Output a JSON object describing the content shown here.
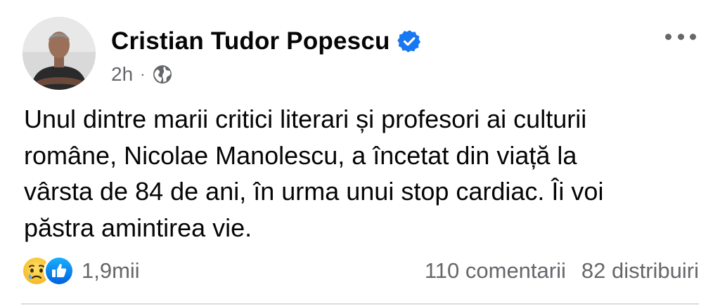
{
  "post": {
    "author": "Cristian Tudor Popescu",
    "verified": true,
    "time": "2h",
    "separator": "·",
    "audience_icon": "globe-icon",
    "text_lines": [
      "Unul dintre marii critici literari și profesori ai culturii",
      "române, Nicolae Manolescu, a încetat din viață la",
      "vârsta de 84 de ani, în urma unui stop cardiac. Îi voi",
      "păstra amintirea vie."
    ],
    "reactions": {
      "icons": [
        "sad-reaction-icon",
        "like-reaction-icon"
      ],
      "count": "1,9mii"
    },
    "comments": "110 comentarii",
    "shares": "82 distribuiri"
  },
  "colors": {
    "verified_blue": "#1877f2",
    "meta_gray": "#65676b",
    "divider": "#dadde1"
  }
}
